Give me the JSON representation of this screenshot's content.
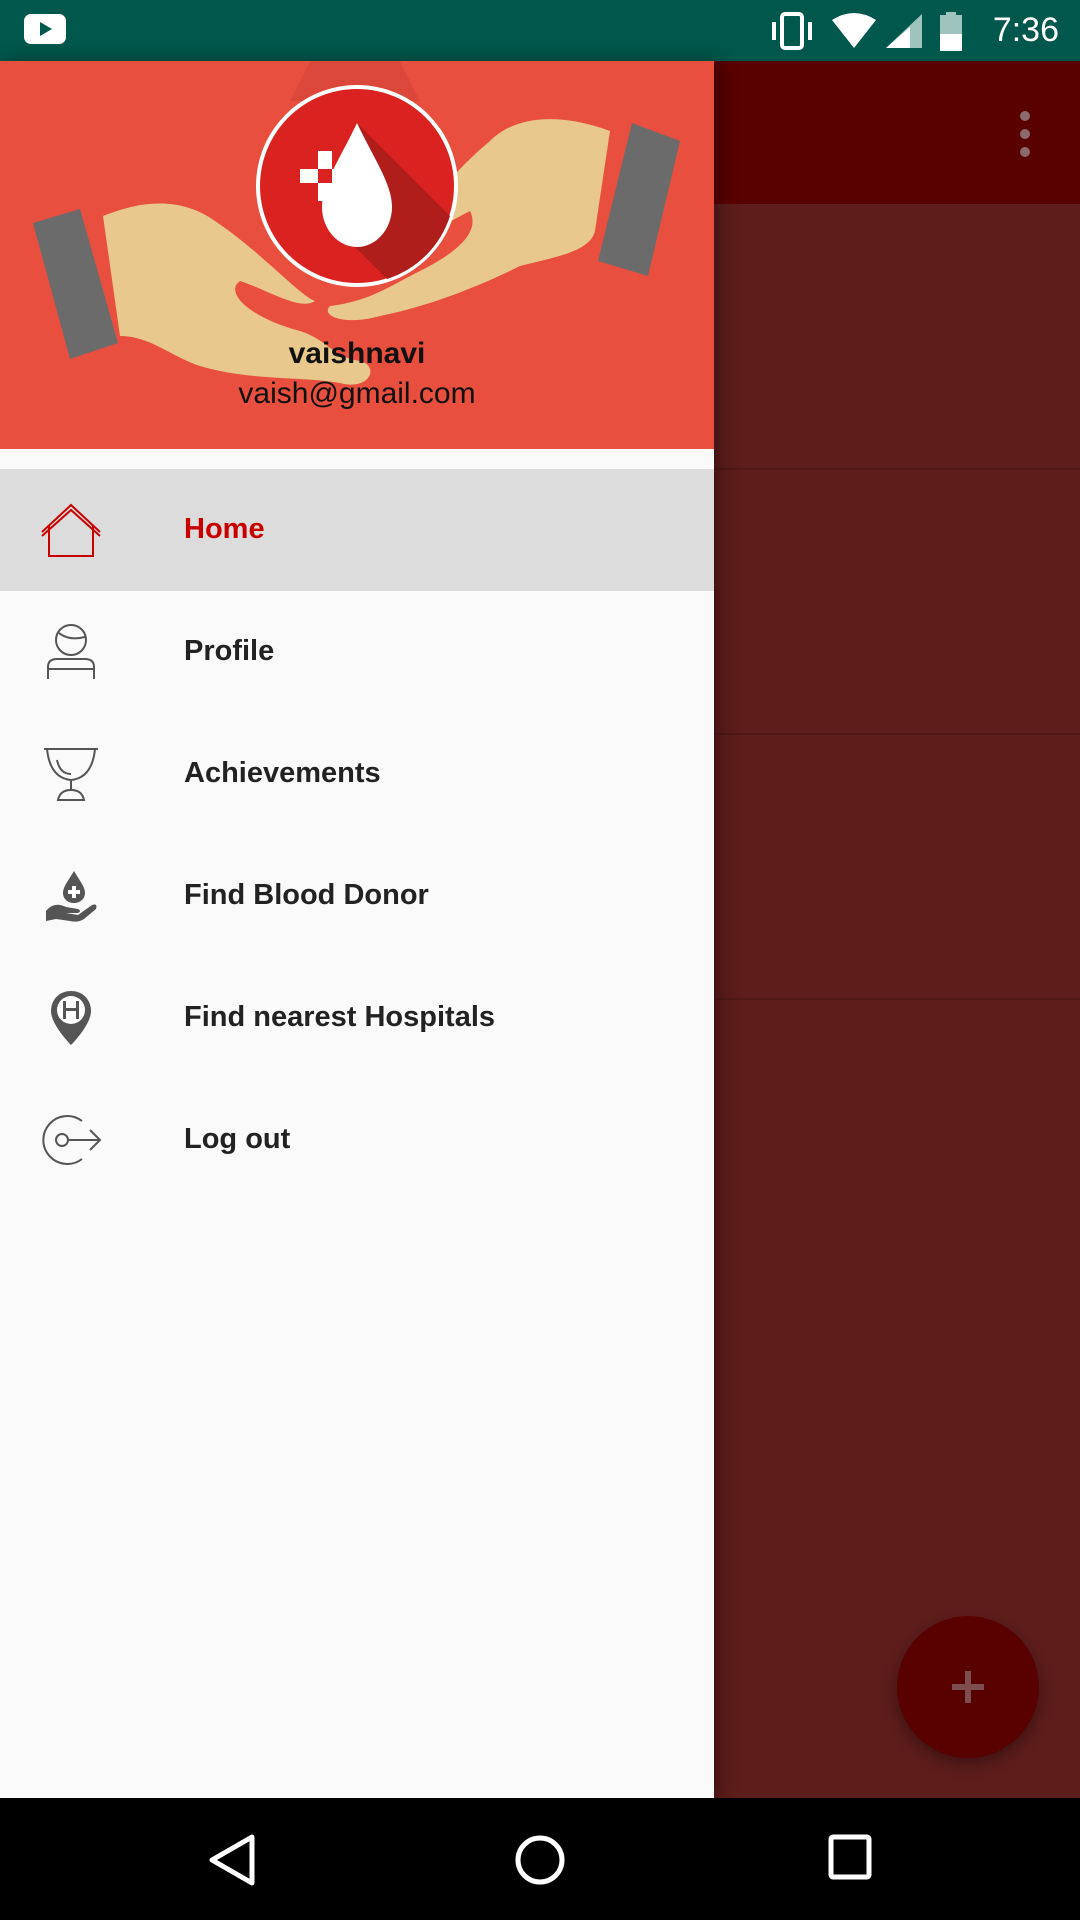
{
  "status_bar": {
    "time": "7:36",
    "icons": [
      "youtube-notification-icon",
      "vibrate-icon",
      "wifi-icon",
      "cell-signal-icon",
      "battery-icon"
    ]
  },
  "drawer": {
    "user": {
      "name": "vaishnavi",
      "email": "vaish@gmail.com"
    },
    "items": [
      {
        "label": "Home",
        "icon": "home-icon",
        "active": true
      },
      {
        "label": "Profile",
        "icon": "profile-icon",
        "active": false
      },
      {
        "label": "Achievements",
        "icon": "trophy-icon",
        "active": false
      },
      {
        "label": "Find Blood Donor",
        "icon": "blood-donor-icon",
        "active": false
      },
      {
        "label": "Find nearest Hospitals",
        "icon": "hospital-pin-icon",
        "active": false
      }
    ],
    "logout": {
      "label": "Log out",
      "icon": "logout-icon"
    }
  },
  "app": {
    "fab_icon": "plus-icon",
    "menu_icon": "more-vert-icon"
  },
  "nav_bar": {
    "buttons": [
      "back-icon",
      "home-circle-icon",
      "recents-icon"
    ]
  },
  "colors": {
    "status_bar": "#00574b",
    "header": "#e84f3e",
    "accent": "#c90000",
    "scrim": "#5d1d1b"
  }
}
